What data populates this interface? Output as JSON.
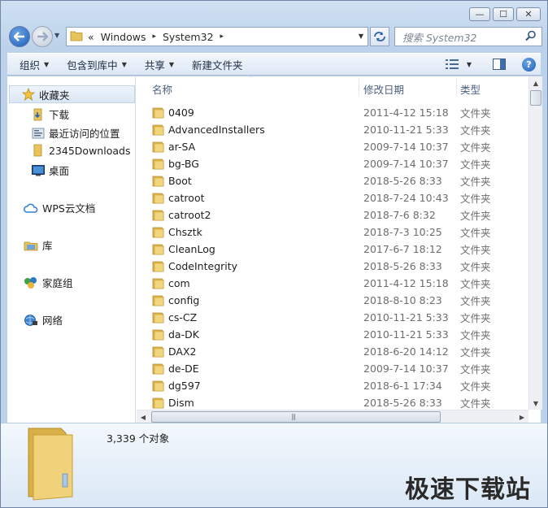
{
  "window": {
    "controls": {
      "minimize": "—",
      "maximize": "☐",
      "close": "✕"
    }
  },
  "address": {
    "prefix": "«",
    "segments": [
      "Windows",
      "System32"
    ],
    "separator": "▸",
    "search_placeholder": "搜索 System32"
  },
  "toolbar": {
    "organize": "组织",
    "include_in_library": "包含到库中",
    "share": "共享",
    "new_folder": "新建文件夹"
  },
  "sidebar": {
    "favorites": {
      "label": "收藏夹",
      "icon": "star-icon"
    },
    "favorite_items": [
      {
        "label": "下载",
        "icon": "download-folder-icon"
      },
      {
        "label": "最近访问的位置",
        "icon": "recent-places-icon"
      },
      {
        "label": "2345Downloads",
        "icon": "folder-icon"
      },
      {
        "label": "桌面",
        "icon": "desktop-icon"
      }
    ],
    "wps": {
      "label": "WPS云文档",
      "icon": "cloud-icon"
    },
    "libraries": {
      "label": "库",
      "icon": "library-icon"
    },
    "homegroup": {
      "label": "家庭组",
      "icon": "homegroup-icon"
    },
    "network": {
      "label": "网络",
      "icon": "network-icon"
    }
  },
  "columns": {
    "name": "名称",
    "date": "修改日期",
    "type": "类型"
  },
  "files": [
    {
      "name": "0409",
      "date": "2011-4-12 15:18",
      "type": "文件夹"
    },
    {
      "name": "AdvancedInstallers",
      "date": "2010-11-21 5:33",
      "type": "文件夹"
    },
    {
      "name": "ar-SA",
      "date": "2009-7-14 10:37",
      "type": "文件夹"
    },
    {
      "name": "bg-BG",
      "date": "2009-7-14 10:37",
      "type": "文件夹"
    },
    {
      "name": "Boot",
      "date": "2018-5-26 8:33",
      "type": "文件夹"
    },
    {
      "name": "catroot",
      "date": "2018-7-24 10:43",
      "type": "文件夹"
    },
    {
      "name": "catroot2",
      "date": "2018-7-6 8:32",
      "type": "文件夹"
    },
    {
      "name": "Chsztk",
      "date": "2018-7-3 10:25",
      "type": "文件夹"
    },
    {
      "name": "CleanLog",
      "date": "2017-6-7 18:12",
      "type": "文件夹"
    },
    {
      "name": "CodeIntegrity",
      "date": "2018-5-26 8:33",
      "type": "文件夹"
    },
    {
      "name": "com",
      "date": "2011-4-12 15:18",
      "type": "文件夹"
    },
    {
      "name": "config",
      "date": "2018-8-10 8:23",
      "type": "文件夹"
    },
    {
      "name": "cs-CZ",
      "date": "2010-11-21 5:33",
      "type": "文件夹"
    },
    {
      "name": "da-DK",
      "date": "2010-11-21 5:33",
      "type": "文件夹"
    },
    {
      "name": "DAX2",
      "date": "2018-6-20 14:12",
      "type": "文件夹"
    },
    {
      "name": "de-DE",
      "date": "2009-7-14 10:37",
      "type": "文件夹"
    },
    {
      "name": "dg597",
      "date": "2018-6-1 17:34",
      "type": "文件夹"
    },
    {
      "name": "Dism",
      "date": "2018-5-26 8:33",
      "type": "文件夹"
    }
  ],
  "details": {
    "count": "3,339 个对象"
  },
  "watermark": "极速下载站",
  "colors": {
    "folder": "#e8c45a",
    "accent": "#1c5db8"
  }
}
